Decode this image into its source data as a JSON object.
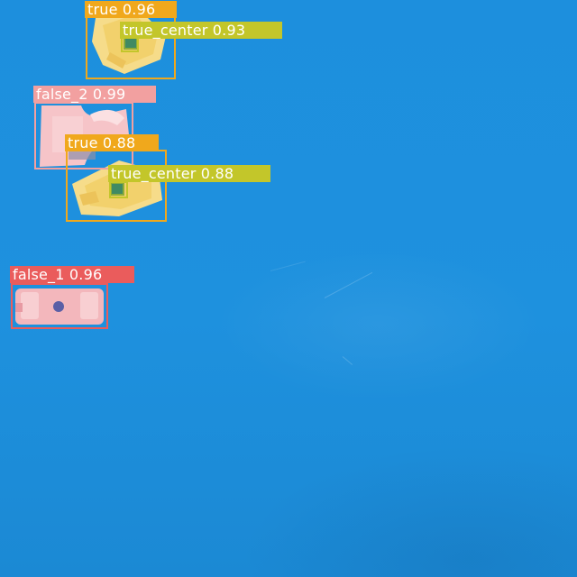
{
  "colors": {
    "background": "#1e8fdc",
    "true": "#f0a81c",
    "true_center": "#c3c62a",
    "false_1": "#ea5c5c",
    "false_2": "#f2a0a0"
  },
  "detections": [
    {
      "id": "det-true-1",
      "class": "true",
      "label": "true 0.96"
    },
    {
      "id": "det-true-center-1",
      "class": "true_center",
      "label": "true_center 0.93"
    },
    {
      "id": "det-false2-1",
      "class": "false_2",
      "label": "false_2 0.99"
    },
    {
      "id": "det-true-2",
      "class": "true",
      "label": "true 0.88"
    },
    {
      "id": "det-true-center-2",
      "class": "true_center",
      "label": "true_center 0.88"
    },
    {
      "id": "det-false1-1",
      "class": "false_1",
      "label": "false_1 0.96"
    }
  ]
}
